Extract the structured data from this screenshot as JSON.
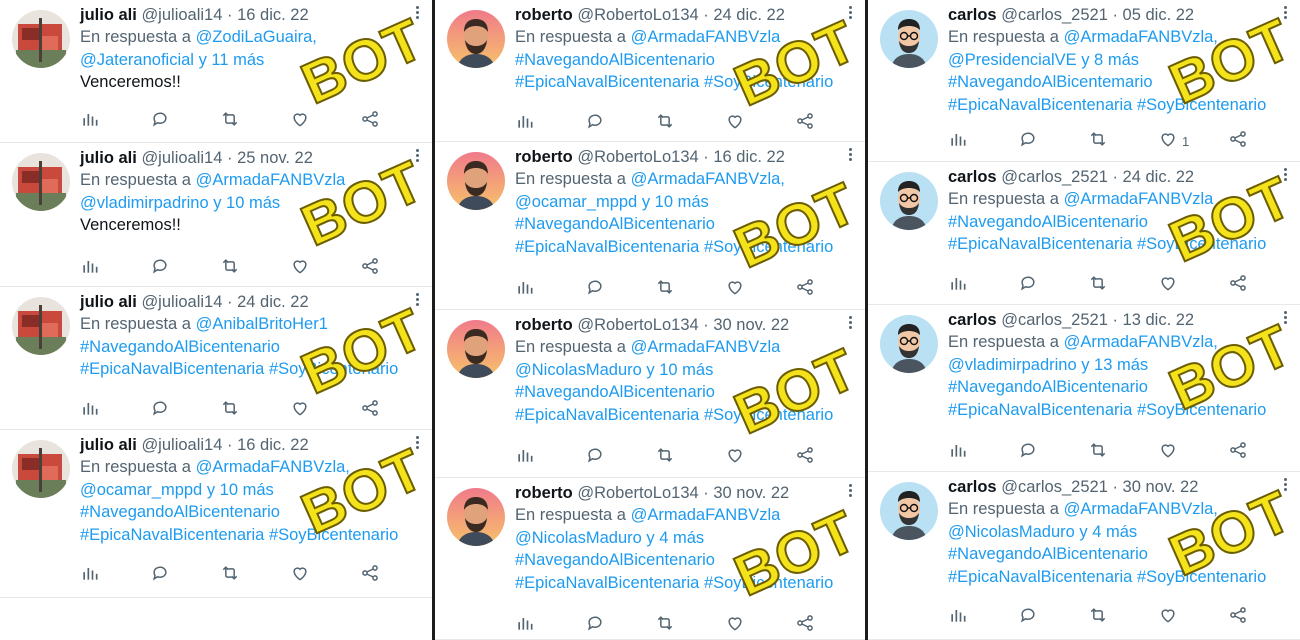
{
  "stamp": "BOT",
  "reply_prefix": "En respuesta a",
  "colors": {
    "link": "#1d9bf0",
    "muted": "#536471",
    "stamp": "#f4e21a"
  },
  "icons": [
    "views-icon",
    "reply-icon",
    "retweet-icon",
    "like-icon",
    "share-icon",
    "more-icon"
  ],
  "columns": [
    {
      "user": "julio ali",
      "handle": "@julioali14",
      "avatar": "red-flag-avatar",
      "tweets": [
        {
          "date": "16 dic. 22",
          "lines": [
            [
              {
                "t": "En respuesta a ",
                "c": "grey"
              },
              {
                "t": "@ZodiLaGuaira,",
                "c": "blue"
              }
            ],
            [
              {
                "t": "@Jateranoficial",
                "c": "blue"
              },
              {
                "t": " y 11 más",
                "c": "blue"
              }
            ],
            [
              {
                "t": "Venceremos!!",
                "c": "plain"
              }
            ]
          ],
          "likes": ""
        },
        {
          "date": "25 nov. 22",
          "lines": [
            [
              {
                "t": "En respuesta a ",
                "c": "grey"
              },
              {
                "t": "@ArmadaFANBVzla",
                "c": "blue"
              }
            ],
            [
              {
                "t": "@vladimirpadrino",
                "c": "blue"
              },
              {
                "t": " y 10 más",
                "c": "blue"
              }
            ],
            [
              {
                "t": "Venceremos!!",
                "c": "plain"
              }
            ]
          ],
          "likes": ""
        },
        {
          "date": "24 dic. 22",
          "lines": [
            [
              {
                "t": "En respuesta a ",
                "c": "grey"
              },
              {
                "t": "@AnibalBritoHer1",
                "c": "blue"
              }
            ],
            [
              {
                "t": "#NavegandoAlBicentenario",
                "c": "blue"
              }
            ],
            [
              {
                "t": "#EpicaNavalBicentenaria #SoyBicentenario",
                "c": "blue"
              }
            ]
          ],
          "likes": ""
        },
        {
          "date": "16 dic. 22",
          "lines": [
            [
              {
                "t": "En respuesta a ",
                "c": "grey"
              },
              {
                "t": "@ArmadaFANBVzla,",
                "c": "blue"
              }
            ],
            [
              {
                "t": "@ocamar_mppd",
                "c": "blue"
              },
              {
                "t": " y 10 más",
                "c": "blue"
              }
            ],
            [
              {
                "t": "#NavegandoAlBicentenario",
                "c": "blue"
              }
            ],
            [
              {
                "t": "#EpicaNavalBicentenaria #SoyBicentenario",
                "c": "blue"
              }
            ]
          ],
          "likes": ""
        }
      ]
    },
    {
      "user": "roberto",
      "handle": "@RobertoLo134",
      "avatar": "bearded-man-avatar",
      "tweets": [
        {
          "date": "24 dic. 22",
          "lines": [
            [
              {
                "t": "En respuesta a ",
                "c": "grey"
              },
              {
                "t": "@ArmadaFANBVzla",
                "c": "blue"
              }
            ],
            [
              {
                "t": "#NavegandoAlBicentenario",
                "c": "blue"
              }
            ],
            [
              {
                "t": "#EpicaNavalBicentenaria #SoyBicentenario",
                "c": "blue"
              }
            ]
          ],
          "likes": ""
        },
        {
          "date": "16 dic. 22",
          "lines": [
            [
              {
                "t": "En respuesta a ",
                "c": "grey"
              },
              {
                "t": "@ArmadaFANBVzla,",
                "c": "blue"
              }
            ],
            [
              {
                "t": "@ocamar_mppd",
                "c": "blue"
              },
              {
                "t": " y 10 más",
                "c": "blue"
              }
            ],
            [
              {
                "t": "#NavegandoAlBicentenario",
                "c": "blue"
              }
            ],
            [
              {
                "t": "#EpicaNavalBicentenaria #SoyBicentenario",
                "c": "blue"
              }
            ]
          ],
          "likes": ""
        },
        {
          "date": "30 nov. 22",
          "lines": [
            [
              {
                "t": "En respuesta a ",
                "c": "grey"
              },
              {
                "t": "@ArmadaFANBVzla",
                "c": "blue"
              }
            ],
            [
              {
                "t": "@NicolasMaduro",
                "c": "blue"
              },
              {
                "t": " y 10 más",
                "c": "blue"
              }
            ],
            [
              {
                "t": "#NavegandoAlBicentenario",
                "c": "blue"
              }
            ],
            [
              {
                "t": "#EpicaNavalBicentenaria #SoyBicentenario",
                "c": "blue"
              }
            ]
          ],
          "likes": ""
        },
        {
          "date": "30 nov. 22",
          "lines": [
            [
              {
                "t": "En respuesta a ",
                "c": "grey"
              },
              {
                "t": "@ArmadaFANBVzla",
                "c": "blue"
              }
            ],
            [
              {
                "t": "@NicolasMaduro",
                "c": "blue"
              },
              {
                "t": " y 4 más",
                "c": "blue"
              }
            ],
            [
              {
                "t": "#NavegandoAlBicentenario",
                "c": "blue"
              }
            ],
            [
              {
                "t": "#EpicaNavalBicentenaria #SoyBicentenario",
                "c": "blue"
              }
            ]
          ],
          "likes": ""
        }
      ]
    },
    {
      "user": "carlos",
      "handle": "@carlos_2521",
      "avatar": "glasses-man-avatar",
      "tweets": [
        {
          "date": "05 dic. 22",
          "lines": [
            [
              {
                "t": "En respuesta a ",
                "c": "grey"
              },
              {
                "t": "@ArmadaFANBVzla,",
                "c": "blue"
              }
            ],
            [
              {
                "t": "@PresidencialVE",
                "c": "blue"
              },
              {
                "t": " y 8 más",
                "c": "blue"
              }
            ],
            [
              {
                "t": "#NavegandoAlBicentemario",
                "c": "blue"
              }
            ],
            [
              {
                "t": "#EpicaNavalBicentenaria #SoyBicentenario",
                "c": "blue"
              }
            ]
          ],
          "likes": "1"
        },
        {
          "date": "24 dic. 22",
          "lines": [
            [
              {
                "t": "En respuesta a ",
                "c": "grey"
              },
              {
                "t": "@ArmadaFANBVzla",
                "c": "blue"
              }
            ],
            [
              {
                "t": "#NavegandoAlBicentenario",
                "c": "blue"
              }
            ],
            [
              {
                "t": "#EpicaNavalBicentenaria #SoyBicentenario",
                "c": "blue"
              }
            ]
          ],
          "likes": ""
        },
        {
          "date": "13 dic. 22",
          "lines": [
            [
              {
                "t": "En respuesta a ",
                "c": "grey"
              },
              {
                "t": "@ArmadaFANBVzla,",
                "c": "blue"
              }
            ],
            [
              {
                "t": "@vladimirpadrino",
                "c": "blue"
              },
              {
                "t": " y 13 más",
                "c": "blue"
              }
            ],
            [
              {
                "t": "#NavegandoAlBicentenario",
                "c": "blue"
              }
            ],
            [
              {
                "t": "#EpicaNavalBicentenaria #SoyBicentenario",
                "c": "blue"
              }
            ]
          ],
          "likes": ""
        },
        {
          "date": "30 nov. 22",
          "lines": [
            [
              {
                "t": "En respuesta a ",
                "c": "grey"
              },
              {
                "t": "@ArmadaFANBVzla,",
                "c": "blue"
              }
            ],
            [
              {
                "t": "@NicolasMaduro",
                "c": "blue"
              },
              {
                "t": " y 4 más",
                "c": "blue"
              }
            ],
            [
              {
                "t": "#NavegandoAlBicentenario",
                "c": "blue"
              }
            ],
            [
              {
                "t": "#EpicaNavalBicentenaria #SoyBicentenario",
                "c": "blue"
              }
            ]
          ],
          "likes": ""
        }
      ]
    }
  ]
}
